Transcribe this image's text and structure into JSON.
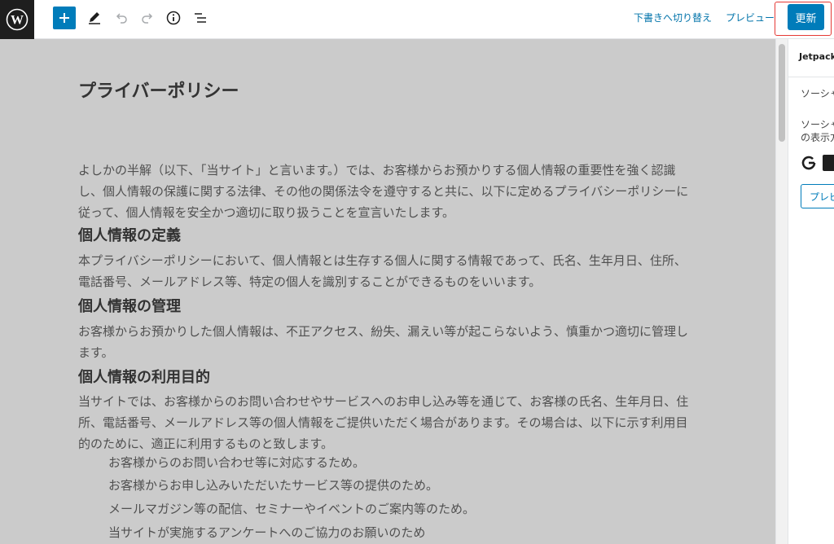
{
  "toolbar": {
    "switch_to_draft": "下書きへ切り替え",
    "preview": "プレビュー",
    "update": "更新",
    "accent_color": "#007cba"
  },
  "editor": {
    "title": "プライバーポリシー",
    "intro": "よしかの半解（以下、「当サイト」と言います。）では、お客様からお預かりする個人情報の重要性を強く認識し、個人情報の保護に関する法律、その他の関係法令を遵守すると共に、以下に定めるプライバシーポリシーに従って、個人情報を安全かつ適切に取り扱うことを宣言いたします。",
    "sections": [
      {
        "heading": "個人情報の定義",
        "body": "本プライバシーポリシーにおいて、個人情報とは生存する個人に関する情報であって、氏名、生年月日、住所、電話番号、メールアドレス等、特定の個人を識別することができるものをいいます。"
      },
      {
        "heading": "個人情報の管理",
        "body": "お客様からお預かりした個人情報は、不正アクセス、紛失、漏えい等が起こらないよう、慎重かつ適切に管理します。"
      },
      {
        "heading": "個人情報の利用目的",
        "body": "当サイトでは、お客様からのお問い合わせやサービスへのお申し込み等を通じて、お客様の氏名、生年月日、住所、電話番号、メールアドレス等の個人情報をご提供いただく場合があります。その場合は、以下に示す利用目的のために、適正に利用するものと致します。"
      }
    ],
    "list": [
      "お客様からのお問い合わせ等に対応するため。",
      "お客様からお申し込みいただいたサービス等の提供のため。",
      "メールマガジン等の配信、セミナーやイベントのご案内等のため。",
      "当サイトが実施するアンケートへのご協力のお願いのため"
    ]
  },
  "sidebar": {
    "title": "Jetpack",
    "text1": "ソーシャ",
    "text2": "ソーシャ",
    "text3": "の表示方",
    "preview_button": "プレビ"
  }
}
